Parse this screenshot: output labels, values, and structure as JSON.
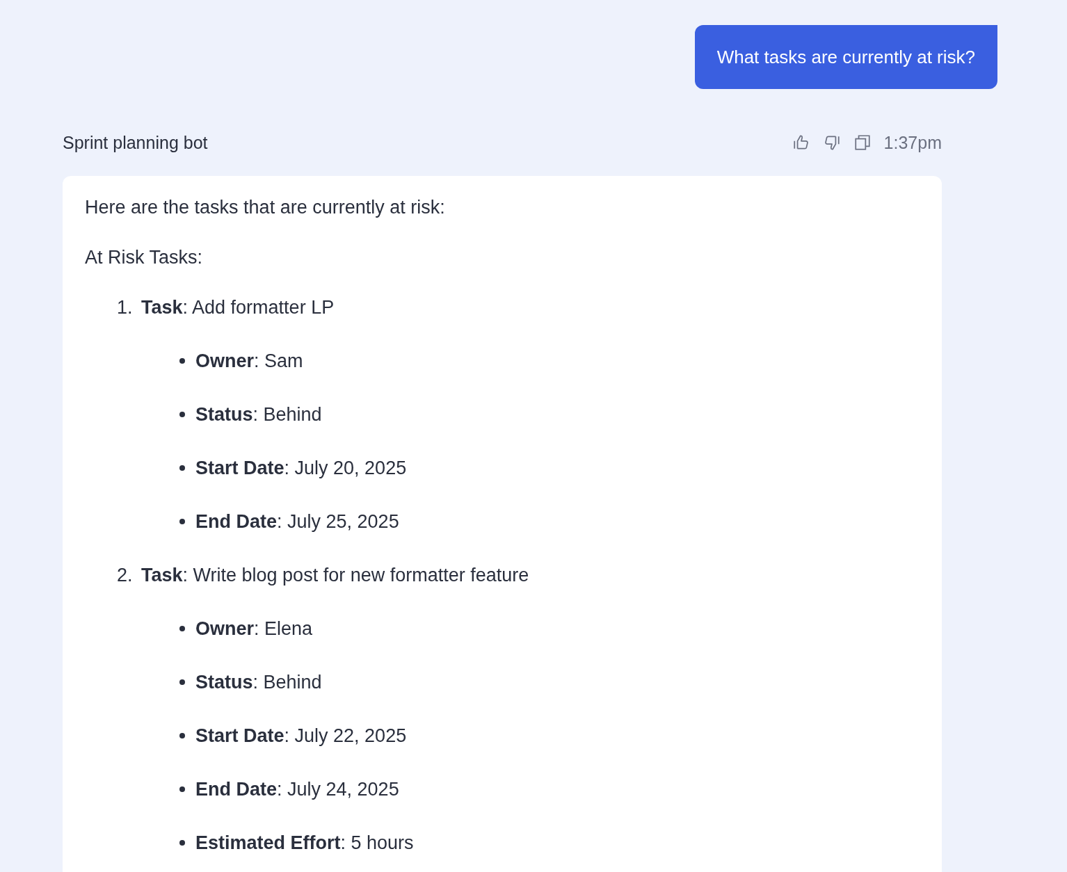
{
  "user_message": {
    "text": "What tasks are currently at risk?"
  },
  "bot_message": {
    "sender": "Sprint planning bot",
    "time": "1:37pm",
    "intro": "Here are the tasks that are currently at risk:",
    "heading": "At Risk Tasks:",
    "tasks": [
      {
        "number": "1.",
        "title": "**Task**: Add formatter LP",
        "details": [
          "**Owner**: Sam",
          "**Status**: Behind",
          "**Start Date**: July 20, 2025",
          "**End Date**: July 25, 2025"
        ]
      },
      {
        "number": "2.",
        "title": "**Task**: Write blog post for new formatter feature",
        "details": [
          "**Owner**: Elena",
          "**Status**: Behind",
          "**Start Date**: July 22, 2025",
          "**End Date**: July 24, 2025",
          "**Estimated Effort**: 5 hours"
        ]
      }
    ]
  }
}
